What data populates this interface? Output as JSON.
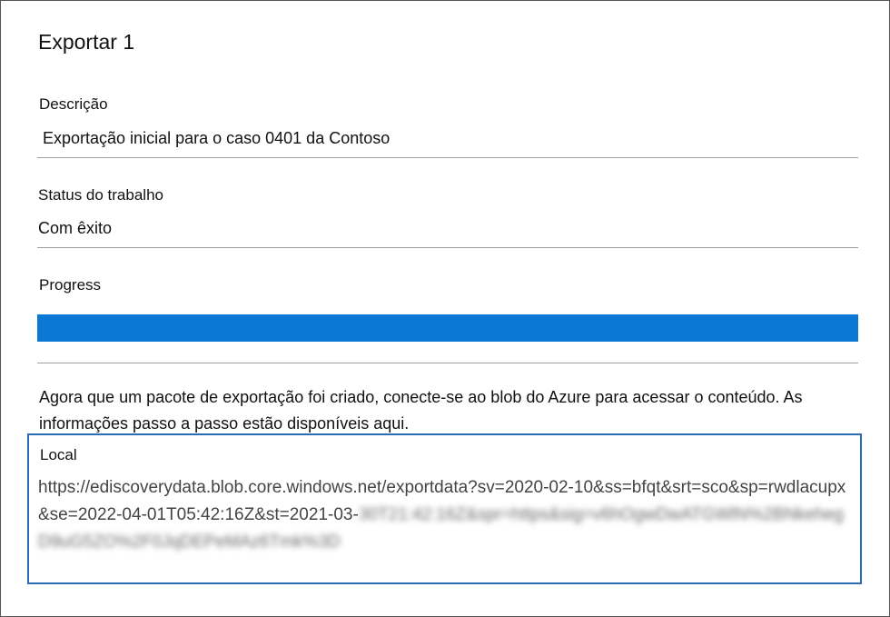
{
  "dialog": {
    "title": "Exportar 1"
  },
  "description": {
    "label": "Descrição",
    "value": "Exportação inicial para o caso 0401 da Contoso"
  },
  "job_status": {
    "label": "Status do trabalho",
    "value": "Com êxito"
  },
  "progress": {
    "label": "Progress",
    "percent": 100,
    "fill_color": "#0a78d4"
  },
  "info_text": "Agora que um pacote de exportação foi criado, conecte-se ao blob do Azure para acessar o conteúdo. As informações passo a passo estão disponíveis aqui.",
  "location": {
    "label": "Local",
    "url_visible": "https://ediscoverydata.blob.core.windows.net/exportdata?sv=2020-02-10&ss=bfqt&srt=sco&sp=rwdlacupx&se=2022-04-01T05:42:16Z&st=2021-03-",
    "url_blurred": "30T21:42:16Z&spr=https&sig=v6hOgwDwATGWlN%2BNkehegD9uG5ZO%2F0JqDEPeMAz6Tmk%3D",
    "border_color": "#2b6cb5"
  }
}
